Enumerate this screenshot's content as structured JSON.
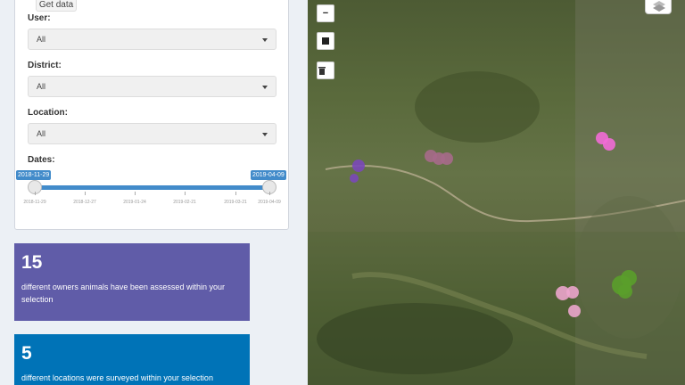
{
  "filters": {
    "get_data_label": "Get data",
    "user": {
      "label": "User:",
      "value": "All"
    },
    "district": {
      "label": "District:",
      "value": "All"
    },
    "location": {
      "label": "Location:",
      "value": "All"
    },
    "dates": {
      "label": "Dates:",
      "from": "2018-11-29",
      "to": "2019-04-09",
      "ticks": [
        "2018-11-29",
        "2018-12-27",
        "2019-01-24",
        "2019-02-21",
        "2019-03-21",
        "2019-04-09"
      ]
    }
  },
  "value_boxes": [
    {
      "value": "15",
      "text": "different owners animals have been assessed within your selection",
      "color": "#605ca8"
    },
    {
      "value": "5",
      "text": "different locations were surveyed within your selection",
      "color": "#0073b7"
    }
  ],
  "map": {
    "zoom_out_label": "−",
    "icons": [
      "zoom-out-icon",
      "stop-square-icon",
      "trash-icon",
      "layers-icon"
    ],
    "markers": [
      {
        "color": "#7a48b8"
      },
      {
        "color": "#a66a8a"
      },
      {
        "color": "#f26bd6"
      },
      {
        "color": "#eba5cc"
      },
      {
        "color": "#5a9e2b"
      }
    ]
  }
}
